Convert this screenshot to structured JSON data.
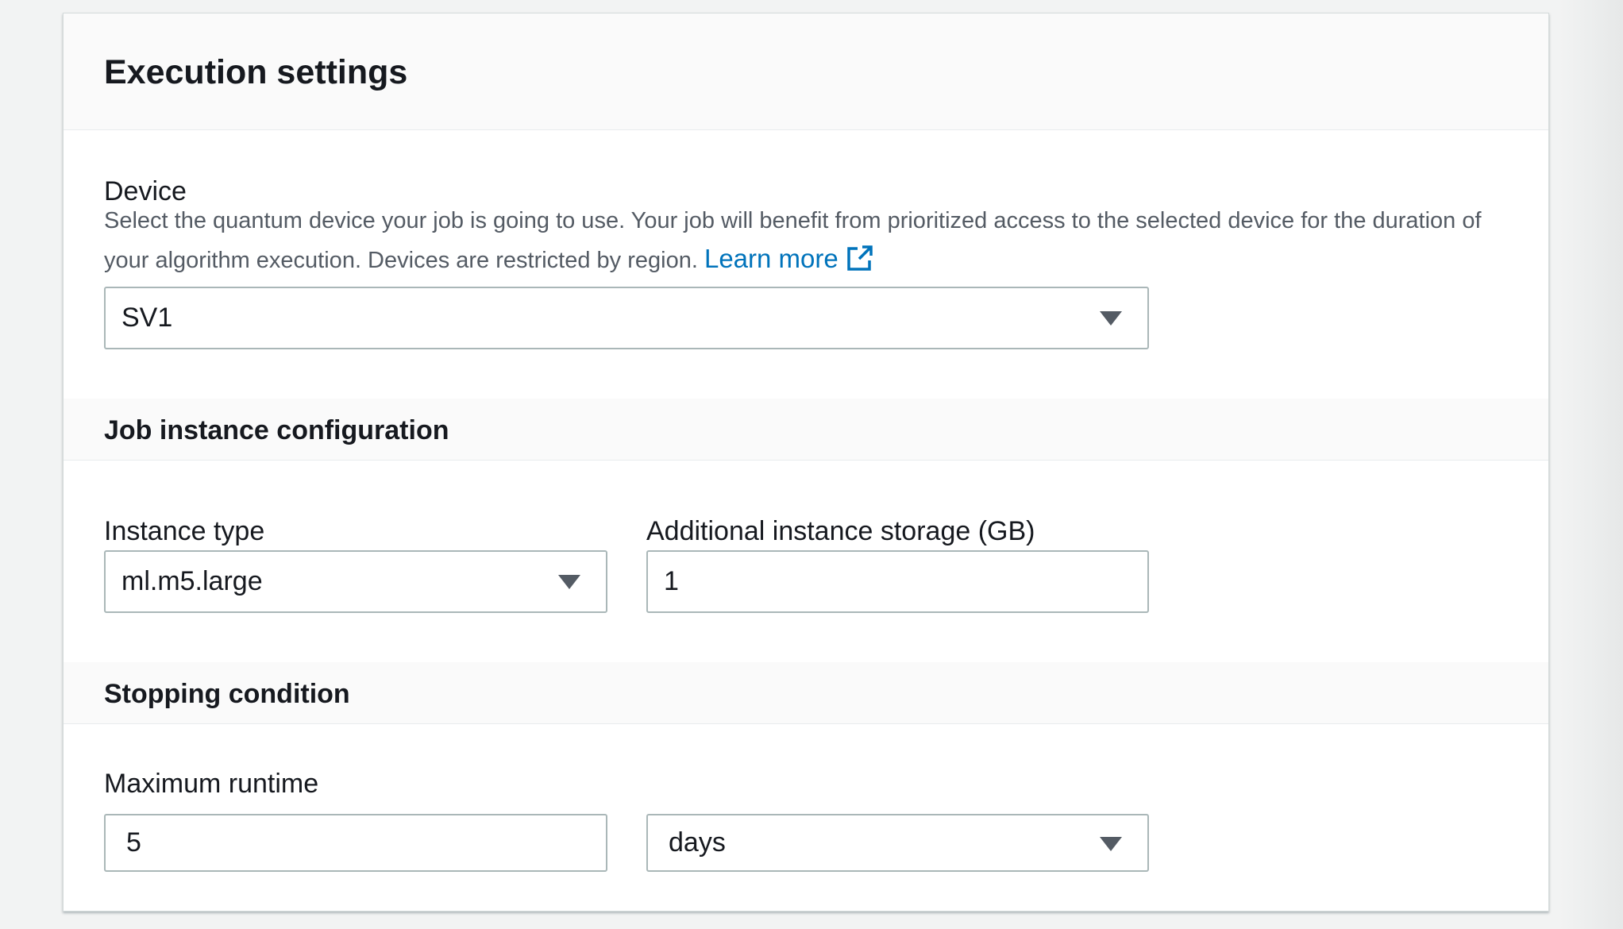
{
  "panel": {
    "title": "Execution settings"
  },
  "device": {
    "label": "Device",
    "description": "Select the quantum device your job is going to use. Your job will benefit from prioritized access to the selected device for the duration of your algorithm execution. Devices are restricted by region.",
    "learn_more": "Learn more",
    "selected": "SV1",
    "icons": {
      "external_link": "external-link-icon",
      "dropdown": "caret-down-icon"
    }
  },
  "job_instance": {
    "section_title": "Job instance configuration",
    "instance_type_label": "Instance type",
    "instance_type_value": "ml.m5.large",
    "storage_label": "Additional instance storage (GB)",
    "storage_value": "1"
  },
  "stopping": {
    "section_title": "Stopping condition",
    "runtime_label": "Maximum runtime",
    "runtime_value": "5",
    "runtime_unit": "days"
  },
  "colors": {
    "link": "#0073bb",
    "text": "#16191f",
    "secondary_text": "#545b64",
    "border": "#aab7b8"
  }
}
